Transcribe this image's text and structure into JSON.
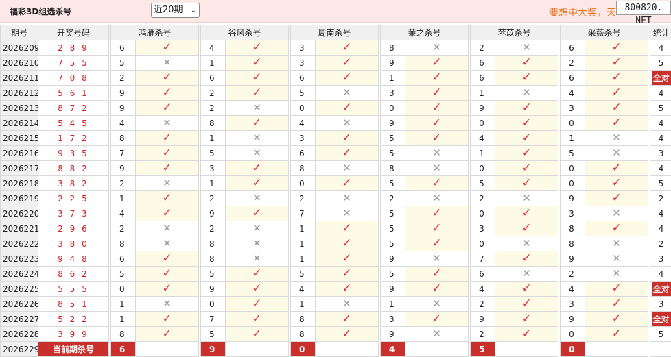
{
  "header": {
    "title": "福彩3D组选杀号",
    "period_select": "近20期",
    "slogan": "要想中大奖，天",
    "site_badge": "800820. NET"
  },
  "table": {
    "columns": {
      "period": "期号",
      "draw": "开奖号码",
      "experts": [
        "鸿雁杀号",
        "谷风杀号",
        "周南杀号",
        "蒹之杀号",
        "芣苡杀号",
        "采薇杀号"
      ],
      "stat": "统计"
    },
    "rows": [
      {
        "period": "2026209",
        "draw": "2 8 9",
        "picks": [
          {
            "num": "6",
            "hit": true
          },
          {
            "num": "4",
            "hit": true
          },
          {
            "num": "3",
            "hit": true
          },
          {
            "num": "8",
            "hit": false
          },
          {
            "num": "2",
            "hit": false
          },
          {
            "num": "6",
            "hit": true
          }
        ],
        "stat": "4"
      },
      {
        "period": "2026210",
        "draw": "7 5 5",
        "picks": [
          {
            "num": "5",
            "hit": false
          },
          {
            "num": "1",
            "hit": true
          },
          {
            "num": "3",
            "hit": true
          },
          {
            "num": "9",
            "hit": true
          },
          {
            "num": "6",
            "hit": true
          },
          {
            "num": "2",
            "hit": true
          }
        ],
        "stat": "5"
      },
      {
        "period": "2026211",
        "draw": "7 0 8",
        "picks": [
          {
            "num": "2",
            "hit": true
          },
          {
            "num": "6",
            "hit": true
          },
          {
            "num": "6",
            "hit": true
          },
          {
            "num": "1",
            "hit": true
          },
          {
            "num": "6",
            "hit": true
          },
          {
            "num": "6",
            "hit": true
          }
        ],
        "stat": "全对"
      },
      {
        "period": "2026212",
        "draw": "5 6 1",
        "picks": [
          {
            "num": "9",
            "hit": true
          },
          {
            "num": "2",
            "hit": true
          },
          {
            "num": "5",
            "hit": false
          },
          {
            "num": "3",
            "hit": true
          },
          {
            "num": "1",
            "hit": false
          },
          {
            "num": "4",
            "hit": true
          }
        ],
        "stat": "4"
      },
      {
        "period": "2026213",
        "draw": "8 7 2",
        "picks": [
          {
            "num": "9",
            "hit": true
          },
          {
            "num": "2",
            "hit": false
          },
          {
            "num": "0",
            "hit": true
          },
          {
            "num": "0",
            "hit": true
          },
          {
            "num": "9",
            "hit": true
          },
          {
            "num": "3",
            "hit": true
          }
        ],
        "stat": "5"
      },
      {
        "period": "2026214",
        "draw": "5 4 5",
        "picks": [
          {
            "num": "4",
            "hit": false
          },
          {
            "num": "8",
            "hit": true
          },
          {
            "num": "4",
            "hit": false
          },
          {
            "num": "9",
            "hit": true
          },
          {
            "num": "0",
            "hit": true
          },
          {
            "num": "0",
            "hit": true
          }
        ],
        "stat": "4"
      },
      {
        "period": "2026215",
        "draw": "1 7 2",
        "picks": [
          {
            "num": "8",
            "hit": true
          },
          {
            "num": "1",
            "hit": false
          },
          {
            "num": "3",
            "hit": true
          },
          {
            "num": "5",
            "hit": true
          },
          {
            "num": "4",
            "hit": true
          },
          {
            "num": "1",
            "hit": false
          }
        ],
        "stat": "4"
      },
      {
        "period": "2026216",
        "draw": "9 3 5",
        "picks": [
          {
            "num": "7",
            "hit": true
          },
          {
            "num": "5",
            "hit": false
          },
          {
            "num": "6",
            "hit": true
          },
          {
            "num": "5",
            "hit": false
          },
          {
            "num": "1",
            "hit": true
          },
          {
            "num": "5",
            "hit": false
          }
        ],
        "stat": "3"
      },
      {
        "period": "2026217",
        "draw": "8 8 2",
        "picks": [
          {
            "num": "9",
            "hit": true
          },
          {
            "num": "3",
            "hit": true
          },
          {
            "num": "8",
            "hit": false
          },
          {
            "num": "8",
            "hit": false
          },
          {
            "num": "0",
            "hit": true
          },
          {
            "num": "0",
            "hit": true
          }
        ],
        "stat": "4"
      },
      {
        "period": "2026218",
        "draw": "3 8 2",
        "picks": [
          {
            "num": "2",
            "hit": false
          },
          {
            "num": "1",
            "hit": true
          },
          {
            "num": "0",
            "hit": true
          },
          {
            "num": "5",
            "hit": true
          },
          {
            "num": "5",
            "hit": true
          },
          {
            "num": "0",
            "hit": true
          }
        ],
        "stat": "5"
      },
      {
        "period": "2026219",
        "draw": "2 2 5",
        "picks": [
          {
            "num": "1",
            "hit": true
          },
          {
            "num": "2",
            "hit": false
          },
          {
            "num": "2",
            "hit": false
          },
          {
            "num": "2",
            "hit": false
          },
          {
            "num": "2",
            "hit": false
          },
          {
            "num": "9",
            "hit": true
          }
        ],
        "stat": "2"
      },
      {
        "period": "2026220",
        "draw": "3 7 3",
        "picks": [
          {
            "num": "4",
            "hit": true
          },
          {
            "num": "9",
            "hit": true
          },
          {
            "num": "7",
            "hit": false
          },
          {
            "num": "5",
            "hit": true
          },
          {
            "num": "0",
            "hit": true
          },
          {
            "num": "3",
            "hit": false
          }
        ],
        "stat": "4"
      },
      {
        "period": "2026221",
        "draw": "2 9 6",
        "picks": [
          {
            "num": "2",
            "hit": false
          },
          {
            "num": "2",
            "hit": false
          },
          {
            "num": "1",
            "hit": true
          },
          {
            "num": "5",
            "hit": true
          },
          {
            "num": "3",
            "hit": true
          },
          {
            "num": "8",
            "hit": true
          }
        ],
        "stat": "4"
      },
      {
        "period": "2026222",
        "draw": "3 8 0",
        "picks": [
          {
            "num": "8",
            "hit": false
          },
          {
            "num": "8",
            "hit": false
          },
          {
            "num": "1",
            "hit": true
          },
          {
            "num": "5",
            "hit": true
          },
          {
            "num": "0",
            "hit": false
          },
          {
            "num": "8",
            "hit": false
          }
        ],
        "stat": "2"
      },
      {
        "period": "2026223",
        "draw": "9 4 8",
        "picks": [
          {
            "num": "6",
            "hit": true
          },
          {
            "num": "8",
            "hit": false
          },
          {
            "num": "1",
            "hit": true
          },
          {
            "num": "9",
            "hit": false
          },
          {
            "num": "7",
            "hit": true
          },
          {
            "num": "9",
            "hit": false
          }
        ],
        "stat": "3"
      },
      {
        "period": "2026224",
        "draw": "8 6 2",
        "picks": [
          {
            "num": "5",
            "hit": true
          },
          {
            "num": "5",
            "hit": true
          },
          {
            "num": "5",
            "hit": true
          },
          {
            "num": "5",
            "hit": true
          },
          {
            "num": "6",
            "hit": false
          },
          {
            "num": "2",
            "hit": false
          }
        ],
        "stat": "4"
      },
      {
        "period": "2026225",
        "draw": "5 5 5",
        "picks": [
          {
            "num": "0",
            "hit": true
          },
          {
            "num": "9",
            "hit": true
          },
          {
            "num": "4",
            "hit": true
          },
          {
            "num": "9",
            "hit": true
          },
          {
            "num": "4",
            "hit": true
          },
          {
            "num": "4",
            "hit": true
          }
        ],
        "stat": "全对"
      },
      {
        "period": "2026226",
        "draw": "8 5 1",
        "picks": [
          {
            "num": "1",
            "hit": false
          },
          {
            "num": "0",
            "hit": true
          },
          {
            "num": "1",
            "hit": false
          },
          {
            "num": "1",
            "hit": false
          },
          {
            "num": "2",
            "hit": true
          },
          {
            "num": "3",
            "hit": true
          }
        ],
        "stat": "3"
      },
      {
        "period": "2026227",
        "draw": "5 2 2",
        "picks": [
          {
            "num": "1",
            "hit": true
          },
          {
            "num": "7",
            "hit": true
          },
          {
            "num": "8",
            "hit": true
          },
          {
            "num": "3",
            "hit": true
          },
          {
            "num": "9",
            "hit": true
          },
          {
            "num": "9",
            "hit": true
          }
        ],
        "stat": "全对"
      },
      {
        "period": "2026228",
        "draw": "3 9 9",
        "picks": [
          {
            "num": "8",
            "hit": true
          },
          {
            "num": "5",
            "hit": true
          },
          {
            "num": "8",
            "hit": true
          },
          {
            "num": "9",
            "hit": false
          },
          {
            "num": "2",
            "hit": true
          },
          {
            "num": "0",
            "hit": true
          }
        ],
        "stat": "5"
      }
    ],
    "current": {
      "period": "2026229",
      "label": "当前期杀号",
      "kills": [
        "6",
        "9",
        "0",
        "4",
        "5",
        "0"
      ]
    }
  },
  "icons": {
    "hit": "check-icon",
    "miss": "cross-icon"
  },
  "colors": {
    "hit": "#e0303f",
    "miss": "#9a9a9a",
    "accent_red": "#c9302c",
    "slogan": "#e8731c"
  }
}
